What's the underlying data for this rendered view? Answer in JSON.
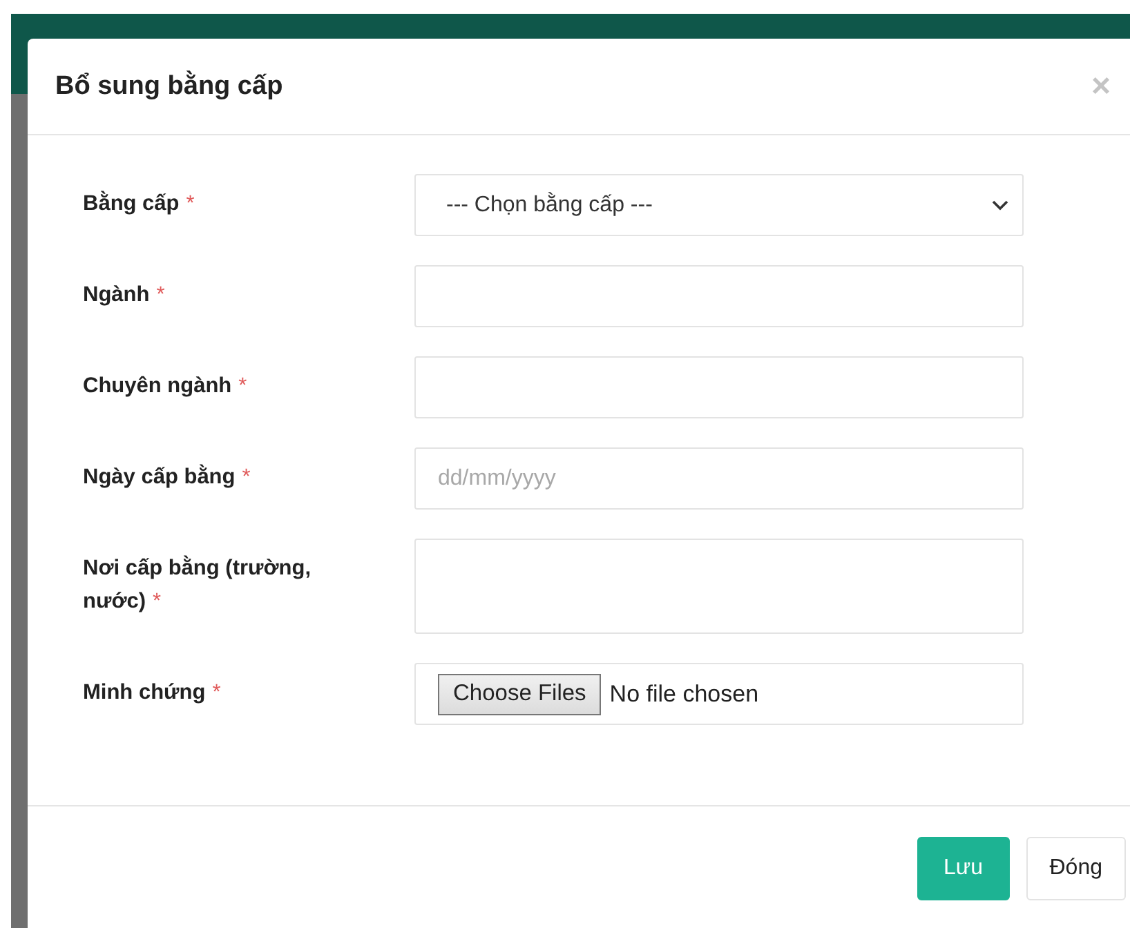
{
  "modal": {
    "title": "Bổ sung bằng cấp",
    "close": "×"
  },
  "fields": [
    {
      "kind": "select",
      "label": "Bằng cấp",
      "required_mark": "*",
      "value": "--- Chọn bằng cấp ---"
    },
    {
      "kind": "text",
      "label": "Ngành",
      "required_mark": "*"
    },
    {
      "kind": "text",
      "label": "Chuyên ngành",
      "required_mark": "*"
    },
    {
      "kind": "date",
      "label": "Ngày cấp bằng",
      "required_mark": "*",
      "placeholder": "dd/mm/yyyy"
    },
    {
      "kind": "textarea",
      "label": "Nơi cấp bằng (trường, nước)",
      "required_mark": "*"
    },
    {
      "kind": "file",
      "label": "Minh chứng",
      "required_mark": "*",
      "button": "Choose Files",
      "status": "No file chosen"
    }
  ],
  "buttons": [
    {
      "label": "Lưu",
      "kind": "primary"
    },
    {
      "label": "Đóng",
      "kind": "default"
    }
  ]
}
